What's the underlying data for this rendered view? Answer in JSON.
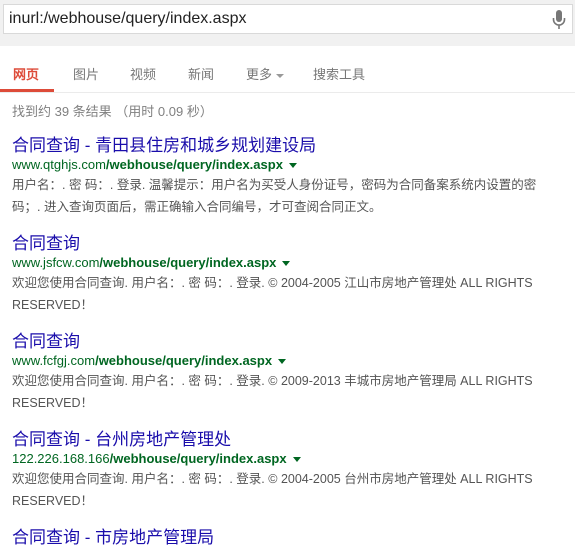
{
  "search": {
    "query": "inurl:/webhouse/query/index.aspx"
  },
  "tabs": [
    {
      "label": "网页"
    },
    {
      "label": "图片"
    },
    {
      "label": "视频"
    },
    {
      "label": "新闻"
    },
    {
      "label": "更多"
    },
    {
      "label": "搜索工具"
    }
  ],
  "stats": "找到约 39 条结果 （用时 0.09 秒）",
  "results": [
    {
      "title": "合同查询 - 青田县住房和城乡规划建设局",
      "url_host": "www.qtghjs.com",
      "url_path": "/webhouse/query/index.aspx",
      "snippet": "用户名：. 密 码：. 登录. 温馨提示：用户名为买受人身份证号，密码为合同备案系统内设置的密码；. 进入查询页面后，需正确输入合同编号，才可查阅合同正文。"
    },
    {
      "title": "合同查询",
      "url_host": "www.jsfcw.com",
      "url_path": "/webhouse/query/index.aspx",
      "snippet": "欢迎您使用合同查询. 用户名：. 密 码：. 登录. © 2004-2005 江山市房地产管理处 ALL RIGHTS RESERVED！"
    },
    {
      "title": "合同查询",
      "url_host": "www.fcfgj.com",
      "url_path": "/webhouse/query/index.aspx",
      "snippet": "欢迎您使用合同查询. 用户名：. 密 码：. 登录. © 2009-2013 丰城市房地产管理局 ALL RIGHTS RESERVED！"
    },
    {
      "title": "合同查询 - 台州房地产管理处",
      "url_host": "122.226.168.166",
      "url_path": "/webhouse/query/index.aspx",
      "snippet": "欢迎您使用合同查询. 用户名：. 密 码：. 登录. © 2004-2005 台州市房地产管理处 ALL RIGHTS RESERVED！"
    },
    {
      "title": "合同查询 - 市房地产管理局",
      "url_host": "",
      "url_path": "",
      "snippet": ""
    }
  ]
}
